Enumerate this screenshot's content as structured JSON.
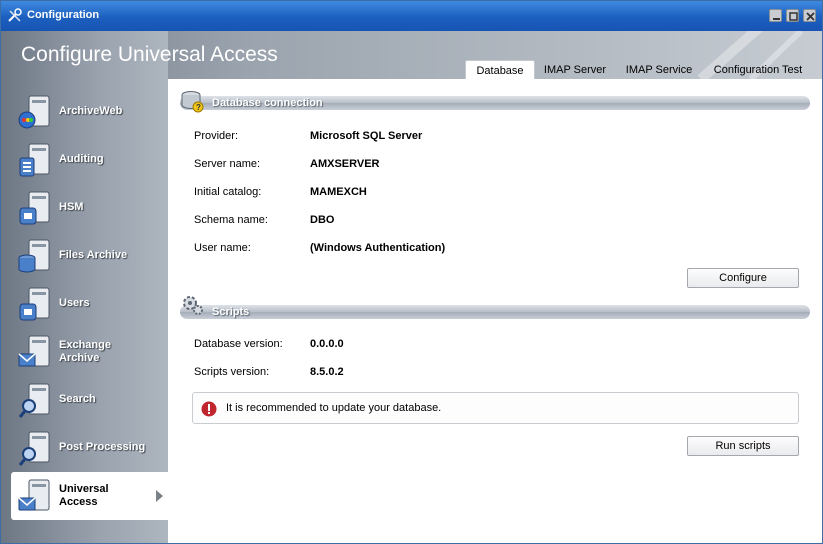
{
  "window": {
    "title": "Configuration"
  },
  "header": {
    "title": "Configure Universal Access"
  },
  "sidebar": {
    "items": [
      {
        "label": "ArchiveWeb"
      },
      {
        "label": "Auditing"
      },
      {
        "label": "HSM"
      },
      {
        "label": "Files Archive"
      },
      {
        "label": "Users"
      },
      {
        "label": "Exchange\nArchive"
      },
      {
        "label": "Search"
      },
      {
        "label": "Post Processing"
      },
      {
        "label": "Universal\nAccess",
        "selected": true
      }
    ]
  },
  "tabs": [
    {
      "label": "Database",
      "active": true
    },
    {
      "label": "IMAP Server"
    },
    {
      "label": "IMAP Service"
    },
    {
      "label": "Configuration Test"
    }
  ],
  "db": {
    "section_title": "Database connection",
    "fields": [
      {
        "label": "Provider:",
        "value": "Microsoft SQL Server"
      },
      {
        "label": "Server name:",
        "value": "AMXSERVER"
      },
      {
        "label": "Initial catalog:",
        "value": "MAMEXCH"
      },
      {
        "label": "Schema name:",
        "value": "DBO"
      },
      {
        "label": "User name:",
        "value": "(Windows Authentication)"
      }
    ],
    "configure_label": "Configure"
  },
  "scripts": {
    "section_title": "Scripts",
    "fields": [
      {
        "label": "Database version:",
        "value": "0.0.0.0"
      },
      {
        "label": "Scripts version:",
        "value": "8.5.0.2"
      }
    ],
    "notice": "It is recommended to update your database.",
    "run_label": "Run scripts"
  },
  "colors": {
    "titlebar": "#1c5fbf",
    "warning": "#c0262d"
  }
}
